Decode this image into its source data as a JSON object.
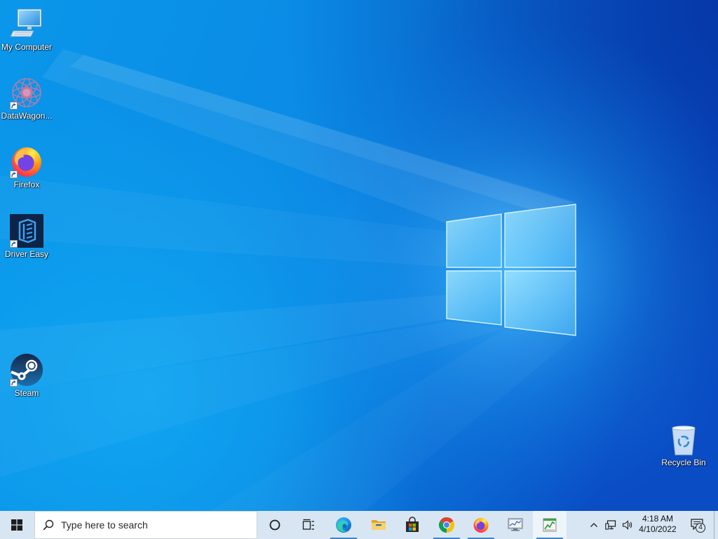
{
  "desktop": {
    "icons": [
      {
        "label": "My Computer",
        "icon": "computer-icon",
        "shortcut": false
      },
      {
        "label": "DataWagon...",
        "icon": "datawagon-icon",
        "shortcut": true
      },
      {
        "label": "Firefox",
        "icon": "firefox-icon",
        "shortcut": true
      },
      {
        "label": "Driver Easy",
        "icon": "driver-easy-icon",
        "shortcut": true
      },
      {
        "label": "Steam",
        "icon": "steam-icon",
        "shortcut": true
      },
      {
        "label": "Recycle Bin",
        "icon": "recycle-bin-icon",
        "shortcut": false
      }
    ]
  },
  "taskbar": {
    "start_icon": "windows-logo-icon",
    "search": {
      "placeholder": "Type here to search",
      "icon": "search-icon"
    },
    "buttons": [
      {
        "icon": "cortana-icon",
        "running": false,
        "active": false
      },
      {
        "icon": "task-view-icon",
        "running": false,
        "active": false
      },
      {
        "icon": "edge-icon",
        "running": true,
        "active": false
      },
      {
        "icon": "file-explorer-icon",
        "running": false,
        "active": false
      },
      {
        "icon": "microsoft-store-icon",
        "running": false,
        "active": false
      },
      {
        "icon": "chrome-icon",
        "running": true,
        "active": false
      },
      {
        "icon": "firefox-icon",
        "running": true,
        "active": false
      },
      {
        "icon": "monitor-app-icon",
        "running": false,
        "active": false
      },
      {
        "icon": "chart-app-icon",
        "running": true,
        "active": true
      }
    ],
    "tray": {
      "icons": [
        "chevron-up-icon",
        "network-icon",
        "volume-icon"
      ],
      "time": "4:18 AM",
      "date": "4/10/2022",
      "notification_icon": "notification-icon",
      "notification_count": "4"
    }
  },
  "colors": {
    "wallpaper_light": "#0a95e8",
    "wallpaper_dark": "#0a4cc4",
    "logo_pane": "#9fe2ff",
    "taskbar_bg": "#d8e6f3",
    "running_indicator": "#3d86c9",
    "desktop_label": "#ffffff"
  }
}
